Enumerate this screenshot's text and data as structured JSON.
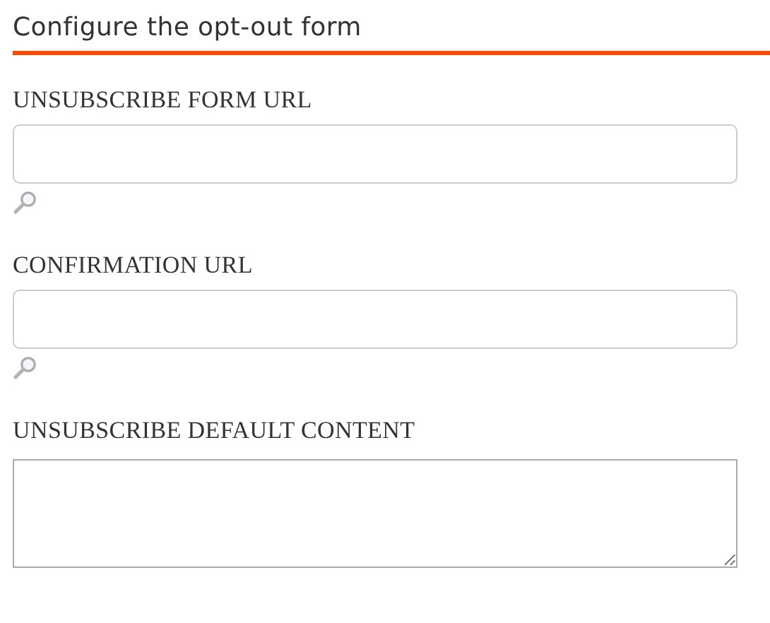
{
  "heading": "Configure the opt-out form",
  "fields": [
    {
      "label": "UNSUBSCRIBE FORM URL",
      "kind": "text",
      "lookup": true
    },
    {
      "label": "CONFIRMATION URL",
      "kind": "text",
      "lookup": true
    },
    {
      "label": "UNSUBSCRIBE DEFAULT CONTENT",
      "kind": "textarea",
      "lookup": false
    }
  ]
}
